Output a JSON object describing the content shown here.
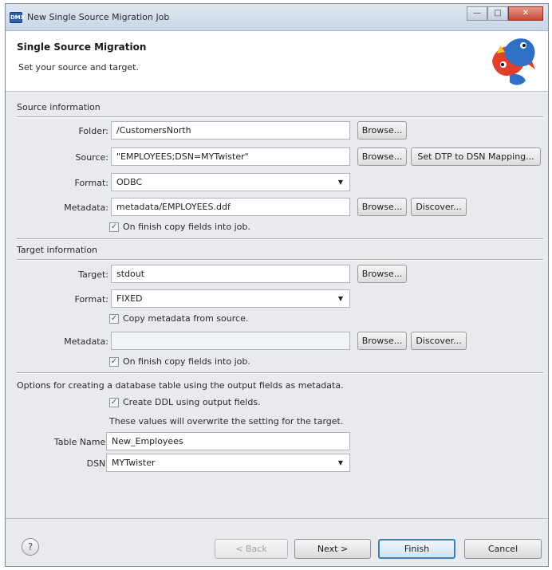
{
  "window": {
    "title": "New Single Source Migration Job",
    "icon_text": "DMX"
  },
  "banner": {
    "title": "Single Source Migration",
    "subtitle": "Set your source and target."
  },
  "source": {
    "heading": "Source information",
    "folder_label": "Folder:",
    "folder_value": "/CustomersNorth",
    "source_label": "Source:",
    "source_value": "\"EMPLOYEES;DSN=MYTwister\"",
    "format_label": "Format:",
    "format_value": "ODBC",
    "metadata_label": "Metadata:",
    "metadata_value": "metadata/EMPLOYEES.ddf",
    "copy_fields_label": "On finish copy fields into job.",
    "copy_fields_checked": true
  },
  "target": {
    "heading": "Target information",
    "target_label": "Target:",
    "target_value": "stdout",
    "format_label": "Format:",
    "format_value": "FIXED",
    "copy_metadata_label": "Copy metadata from source.",
    "copy_metadata_checked": true,
    "metadata_label": "Metadata:",
    "metadata_value": "",
    "copy_fields_label": "On finish copy fields into job.",
    "copy_fields_checked": true
  },
  "db_options": {
    "heading": "Options for creating a database table using the output fields as metadata.",
    "create_ddl_label": "Create DDL using output fields.",
    "create_ddl_checked": true,
    "note": "These values will overwrite the setting for the target.",
    "table_name_label": "Table Name:",
    "table_name_value": "New_Employees",
    "dsn_label": "DSN:",
    "dsn_value": "MYTwister"
  },
  "buttons": {
    "browse": "Browse...",
    "discover": "Discover...",
    "set_dtp": "Set DTP to DSN Mapping...",
    "back": "< Back",
    "next": "Next >",
    "finish": "Finish",
    "cancel": "Cancel",
    "help": "?"
  },
  "check_mark": "✓",
  "colors": {
    "logo_red": "#e0402b",
    "logo_blue": "#2f6fc6",
    "default_button_border": "#3c7fb1"
  }
}
